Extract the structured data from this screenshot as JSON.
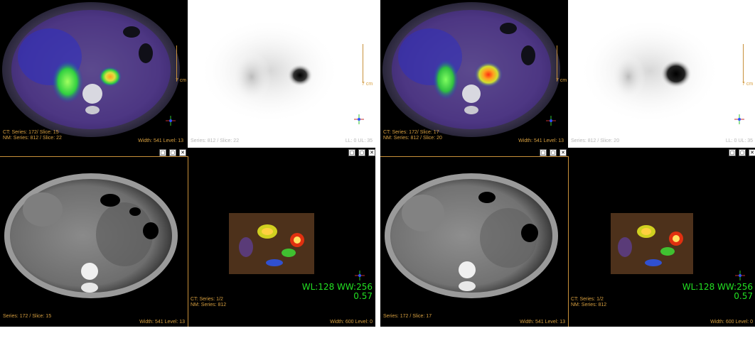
{
  "panels": [
    {
      "fusion": {
        "ct_label": "CT: Series: 172/ Slice: 15",
        "nm_label": "NM: Series: 812 / Slice: 22",
        "width_level": "Width: 541 Level: 13",
        "scale_label": "7 cm"
      },
      "pet": {
        "series_label": "Series: 812 / Slice: 22",
        "level_label": "LL: 0 UL: 35",
        "scale_label": "7 cm"
      },
      "ct": {
        "series_label": "Series: 172 / Slice: 15",
        "width_level": "Width: 541 Level: 13"
      },
      "mip": {
        "ct_label": "CT: Series: 1/2",
        "nm_label": "NM: Series: 812",
        "wl": "WL:128 WW:256",
        "ratio": "0.57",
        "width_level": "Width: 600 Level: 0"
      },
      "controls": {
        "minimize": "□",
        "maximize": "▢",
        "close": "✕"
      }
    },
    {
      "fusion": {
        "ct_label": "CT: Series: 172/ Slice: 17",
        "nm_label": "NM: Series: 812 / Slice: 20",
        "width_level": "Width: 541 Level: 13",
        "scale_label": "7 cm"
      },
      "pet": {
        "series_label": "Series: 812 / Slice: 20",
        "level_label": "LL: 0 UL: 35",
        "scale_label": "7 cm"
      },
      "ct": {
        "series_label": "Series: 172 / Slice: 17",
        "width_level": "Width: 541 Level: 13"
      },
      "mip": {
        "ct_label": "CT: Series: 1/2",
        "nm_label": "NM: Series: 812",
        "wl": "WL:128 WW:256",
        "ratio": "0.57",
        "width_level": "Width: 600 Level: 0"
      },
      "controls": {
        "minimize": "□",
        "maximize": "▢",
        "close": "✕"
      }
    }
  ],
  "colors": {
    "overlay_text": "#d8a040",
    "wl_text": "#22e022",
    "accent_border": "#c8903a"
  }
}
